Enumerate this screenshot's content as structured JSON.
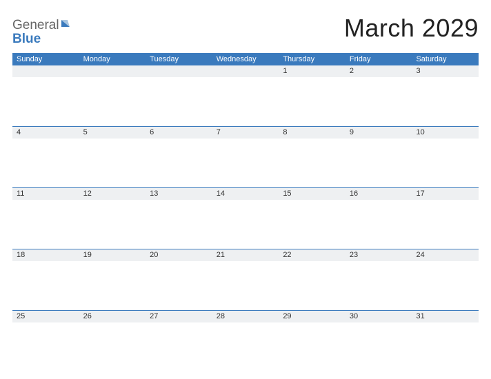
{
  "logo": {
    "text_general": "General",
    "text_blue": "Blue"
  },
  "title": "March 2029",
  "day_names": [
    "Sunday",
    "Monday",
    "Tuesday",
    "Wednesday",
    "Thursday",
    "Friday",
    "Saturday"
  ],
  "weeks": [
    [
      "",
      "",
      "",
      "",
      "1",
      "2",
      "3"
    ],
    [
      "4",
      "5",
      "6",
      "7",
      "8",
      "9",
      "10"
    ],
    [
      "11",
      "12",
      "13",
      "14",
      "15",
      "16",
      "17"
    ],
    [
      "18",
      "19",
      "20",
      "21",
      "22",
      "23",
      "24"
    ],
    [
      "25",
      "26",
      "27",
      "28",
      "29",
      "30",
      "31"
    ]
  ]
}
